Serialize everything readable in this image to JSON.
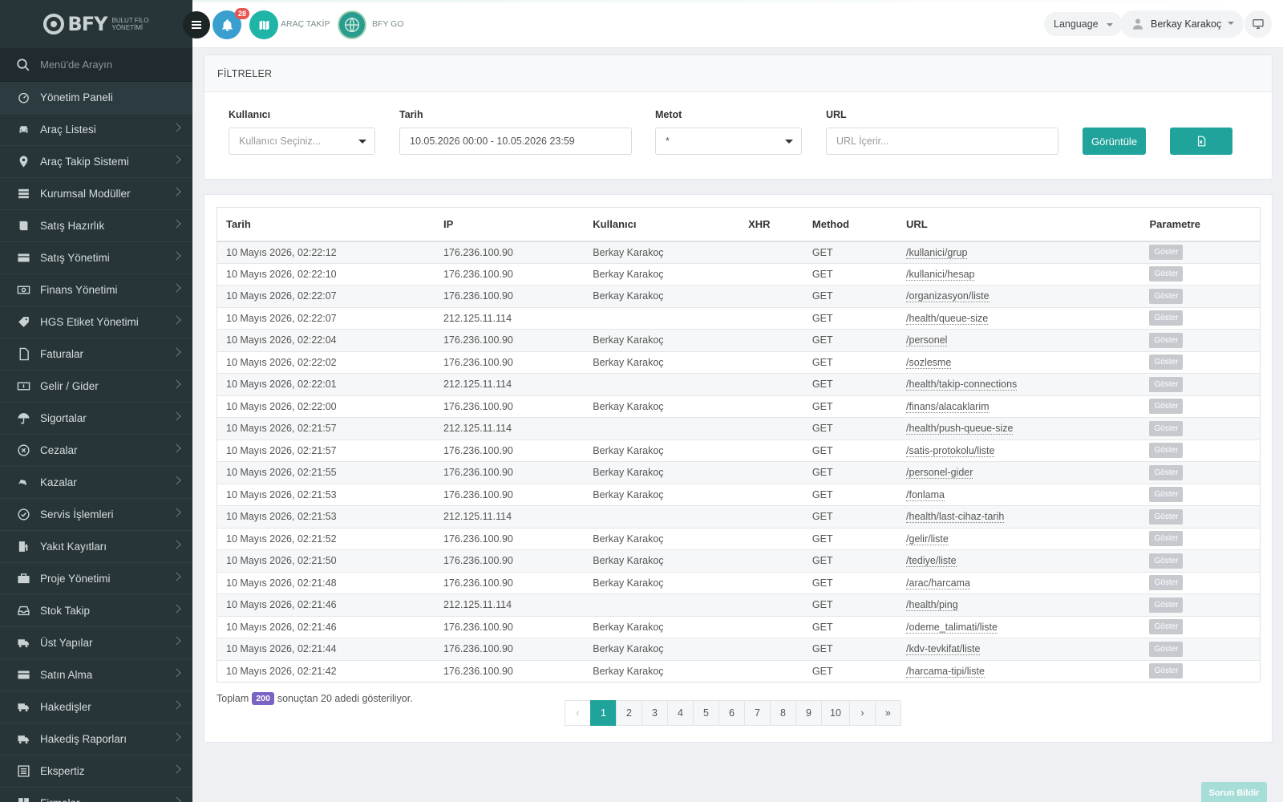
{
  "brand": {
    "logo_text": "BFY",
    "logo_sub_1": "BULUT FİLO",
    "logo_sub_2": "YÖNETİMİ"
  },
  "sidebar": {
    "search_placeholder": "Menü'de Arayın",
    "items": [
      {
        "label": "Yönetim Paneli",
        "icon": "dashboard-icon",
        "chevron": false
      },
      {
        "label": "Araç Listesi",
        "icon": "car-icon",
        "chevron": true
      },
      {
        "label": "Araç Takip Sistemi",
        "icon": "map-pin-icon",
        "chevron": true
      },
      {
        "label": "Kurumsal Modüller",
        "icon": "server-icon",
        "chevron": true
      },
      {
        "label": "Satış Hazırlık",
        "icon": "book-icon",
        "chevron": true
      },
      {
        "label": "Satış Yönetimi",
        "icon": "credit-card-icon",
        "chevron": true
      },
      {
        "label": "Finans Yönetimi",
        "icon": "money-icon",
        "chevron": true
      },
      {
        "label": "HGS Etiket Yönetimi",
        "icon": "tag-icon",
        "chevron": true
      },
      {
        "label": "Faturalar",
        "icon": "file-icon",
        "chevron": true
      },
      {
        "label": "Gelir / Gider",
        "icon": "cash-icon",
        "chevron": true
      },
      {
        "label": "Sigortalar",
        "icon": "umbrella-icon",
        "chevron": true
      },
      {
        "label": "Cezalar",
        "icon": "x-circle-icon",
        "chevron": true
      },
      {
        "label": "Kazalar",
        "icon": "car-crash-icon",
        "chevron": true
      },
      {
        "label": "Servis İşlemleri",
        "icon": "check-circle-icon",
        "chevron": true
      },
      {
        "label": "Yakıt Kayıtları",
        "icon": "fuel-icon",
        "chevron": true
      },
      {
        "label": "Proje Yönetimi",
        "icon": "briefcase-icon",
        "chevron": true
      },
      {
        "label": "Stok Takip",
        "icon": "inbox-icon",
        "chevron": true
      },
      {
        "label": "Üst Yapılar",
        "icon": "truck-icon",
        "chevron": true
      },
      {
        "label": "Satın Alma",
        "icon": "credit-card-icon",
        "chevron": true
      },
      {
        "label": "Hakedişler",
        "icon": "truck-icon",
        "chevron": true
      },
      {
        "label": "Hakediş Raporları",
        "icon": "truck-icon",
        "chevron": true
      },
      {
        "label": "Ekspertiz",
        "icon": "list-icon",
        "chevron": true
      },
      {
        "label": "Firmalar",
        "icon": "grid-icon",
        "chevron": true
      }
    ]
  },
  "topbar": {
    "notification_count": "28",
    "arac_takip_label": "ARAÇ TAKİP",
    "bfy_go_label": "BFY GO",
    "language_label": "Language",
    "user_name": "Berkay Karakoç"
  },
  "filters": {
    "title": "FİLTRELER",
    "user_label": "Kullanıcı",
    "user_placeholder": "Kullanıcı Seçiniz...",
    "date_label": "Tarih",
    "date_value": "10.05.2026 00:00 - 10.05.2026 23:59",
    "method_label": "Metot",
    "method_value": "*",
    "url_label": "URL",
    "url_placeholder": "URL İçerir...",
    "view_button": "Görüntüle"
  },
  "table": {
    "headers": [
      "Tarih",
      "IP",
      "Kullanıcı",
      "XHR",
      "Method",
      "URL",
      "Parametre"
    ],
    "show_label": "Göster",
    "rows": [
      [
        "10 Mayıs 2026, 02:22:12",
        "176.236.100.90",
        "Berkay Karakoç",
        "",
        "GET",
        "/kullanici/grup"
      ],
      [
        "10 Mayıs 2026, 02:22:10",
        "176.236.100.90",
        "Berkay Karakoç",
        "",
        "GET",
        "/kullanici/hesap"
      ],
      [
        "10 Mayıs 2026, 02:22:07",
        "176.236.100.90",
        "Berkay Karakoç",
        "",
        "GET",
        "/organizasyon/liste"
      ],
      [
        "10 Mayıs 2026, 02:22:07",
        "212.125.11.114",
        "",
        "",
        "GET",
        "/health/queue-size"
      ],
      [
        "10 Mayıs 2026, 02:22:04",
        "176.236.100.90",
        "Berkay Karakoç",
        "",
        "GET",
        "/personel"
      ],
      [
        "10 Mayıs 2026, 02:22:02",
        "176.236.100.90",
        "Berkay Karakoç",
        "",
        "GET",
        "/sozlesme"
      ],
      [
        "10 Mayıs 2026, 02:22:01",
        "212.125.11.114",
        "",
        "",
        "GET",
        "/health/takip-connections"
      ],
      [
        "10 Mayıs 2026, 02:22:00",
        "176.236.100.90",
        "Berkay Karakoç",
        "",
        "GET",
        "/finans/alacaklarim"
      ],
      [
        "10 Mayıs 2026, 02:21:57",
        "212.125.11.114",
        "",
        "",
        "GET",
        "/health/push-queue-size"
      ],
      [
        "10 Mayıs 2026, 02:21:57",
        "176.236.100.90",
        "Berkay Karakoç",
        "",
        "GET",
        "/satis-protokolu/liste"
      ],
      [
        "10 Mayıs 2026, 02:21:55",
        "176.236.100.90",
        "Berkay Karakoç",
        "",
        "GET",
        "/personel-gider"
      ],
      [
        "10 Mayıs 2026, 02:21:53",
        "176.236.100.90",
        "Berkay Karakoç",
        "",
        "GET",
        "/fonlama"
      ],
      [
        "10 Mayıs 2026, 02:21:53",
        "212.125.11.114",
        "",
        "",
        "GET",
        "/health/last-cihaz-tarih"
      ],
      [
        "10 Mayıs 2026, 02:21:52",
        "176.236.100.90",
        "Berkay Karakoç",
        "",
        "GET",
        "/gelir/liste"
      ],
      [
        "10 Mayıs 2026, 02:21:50",
        "176.236.100.90",
        "Berkay Karakoç",
        "",
        "GET",
        "/tediye/liste"
      ],
      [
        "10 Mayıs 2026, 02:21:48",
        "176.236.100.90",
        "Berkay Karakoç",
        "",
        "GET",
        "/arac/harcama"
      ],
      [
        "10 Mayıs 2026, 02:21:46",
        "212.125.11.114",
        "",
        "",
        "GET",
        "/health/ping"
      ],
      [
        "10 Mayıs 2026, 02:21:46",
        "176.236.100.90",
        "Berkay Karakoç",
        "",
        "GET",
        "/odeme_talimati/liste"
      ],
      [
        "10 Mayıs 2026, 02:21:44",
        "176.236.100.90",
        "Berkay Karakoç",
        "",
        "GET",
        "/kdv-tevkifat/liste"
      ],
      [
        "10 Mayıs 2026, 02:21:42",
        "176.236.100.90",
        "Berkay Karakoç",
        "",
        "GET",
        "/harcama-tipi/liste"
      ]
    ]
  },
  "summary": {
    "prefix": "Toplam",
    "total": "200",
    "suffix": "sonuçtan 20 adedi gösteriliyor."
  },
  "pagination": {
    "prev": "‹",
    "pages": [
      "1",
      "2",
      "3",
      "4",
      "5",
      "6",
      "7",
      "8",
      "9",
      "10"
    ],
    "next": "›",
    "last": "»",
    "active": "1"
  },
  "report_button": "Sorun Bildir",
  "colors": {
    "accent": "#1fa39a",
    "sidebar": "#273538",
    "badge": "#e8554e",
    "count_badge": "#7b63c4"
  }
}
